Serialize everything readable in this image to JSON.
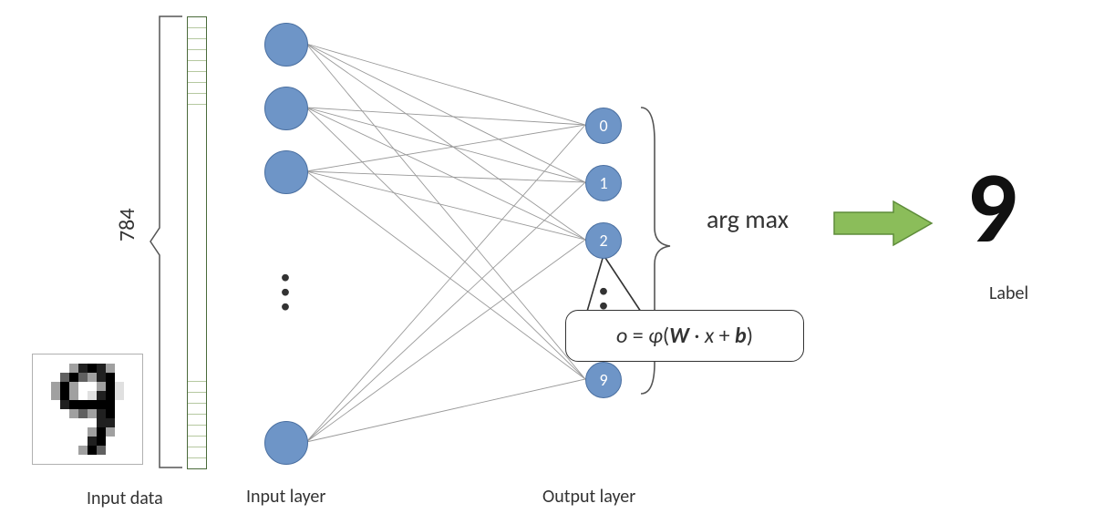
{
  "diagram": {
    "input_size": "784",
    "labels": {
      "input_data": "Input data",
      "input_layer": "Input layer",
      "output_layer": "Output layer",
      "result_label": "Label"
    },
    "output_nodes": [
      "0",
      "1",
      "2",
      "9"
    ],
    "num_output_classes": 10,
    "operation": "arg max",
    "formula": "o = φ(W · x + b)",
    "formula_parts": {
      "o": "o",
      "eq": " = ",
      "phi": "φ",
      "open": "(",
      "W": "W",
      "dot": " · ",
      "x": "x",
      "plus": " + ",
      "b": "b",
      "close": ")"
    },
    "predicted_digit": "9",
    "example_input_digit": "9",
    "colors": {
      "node_fill": "#6e95c7",
      "node_stroke": "#4a6fa0",
      "arrow_fill": "#8bbd5a",
      "arrow_stroke": "#5e8c3a"
    }
  }
}
